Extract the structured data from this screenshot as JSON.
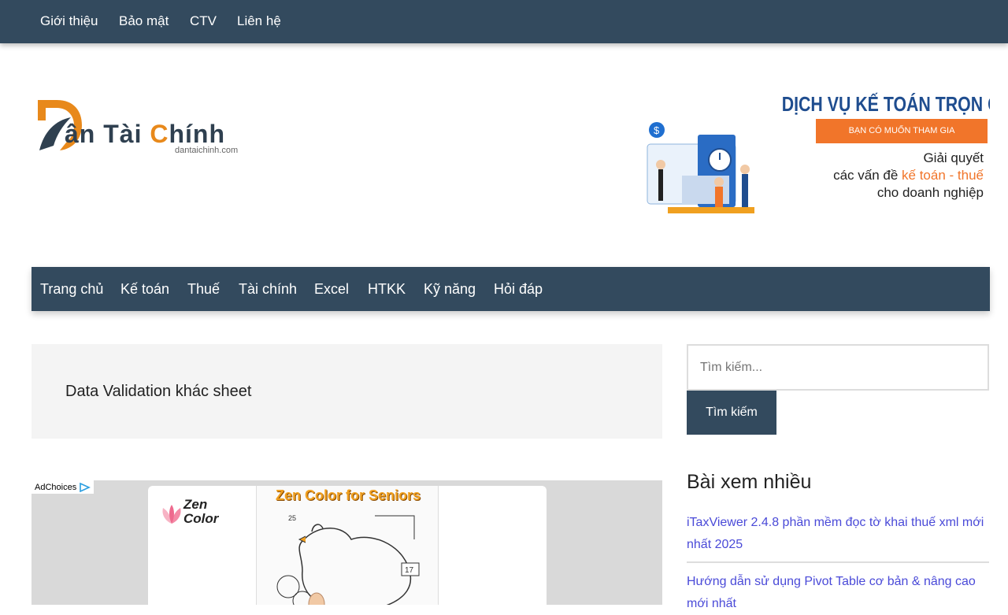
{
  "top_nav": [
    "Giới thiệu",
    "Bảo mật",
    "CTV",
    "Liên hệ"
  ],
  "logo": {
    "brand_prefix": "ân Tài ",
    "brand_c": "C",
    "brand_rest": "hính",
    "subtitle": "dantaichinh.com"
  },
  "banner": {
    "heading": "DỊCH VỤ KẾ TOÁN TRỌN GÓI",
    "pill": "BẠN CÓ MUỐN THAM GIA",
    "line1": "Giải quyết",
    "line2_pre": "các vấn đề ",
    "line2_accent": "kế toán - thuế",
    "line3": "cho doanh nghiệp"
  },
  "main_nav": [
    "Trang chủ",
    "Kế toán",
    "Thuế",
    "Tài chính",
    "Excel",
    "HTKK",
    "Kỹ năng",
    "Hỏi đáp"
  ],
  "page_title": "Data Validation khác sheet",
  "ad": {
    "adchoices": "AdChoices",
    "brand_line1": "Zen",
    "brand_line2": "Color",
    "art_title": "Zen Color for Seniors",
    "art_num1": "25",
    "art_num2": "17"
  },
  "search": {
    "placeholder": "Tìm kiếm...",
    "button": "Tìm kiếm"
  },
  "sidebar": {
    "title": "Bài xem nhiều",
    "links": [
      "iTaxViewer 2.4.8 phần mềm đọc tờ khai thuế xml mới nhất 2025",
      "Hướng dẫn sử dụng Pivot Table cơ bản & nâng cao mới nhất"
    ]
  },
  "colors": {
    "nav_bg": "#334a5e",
    "accent": "#e8891b",
    "link": "#4a4ad8"
  }
}
